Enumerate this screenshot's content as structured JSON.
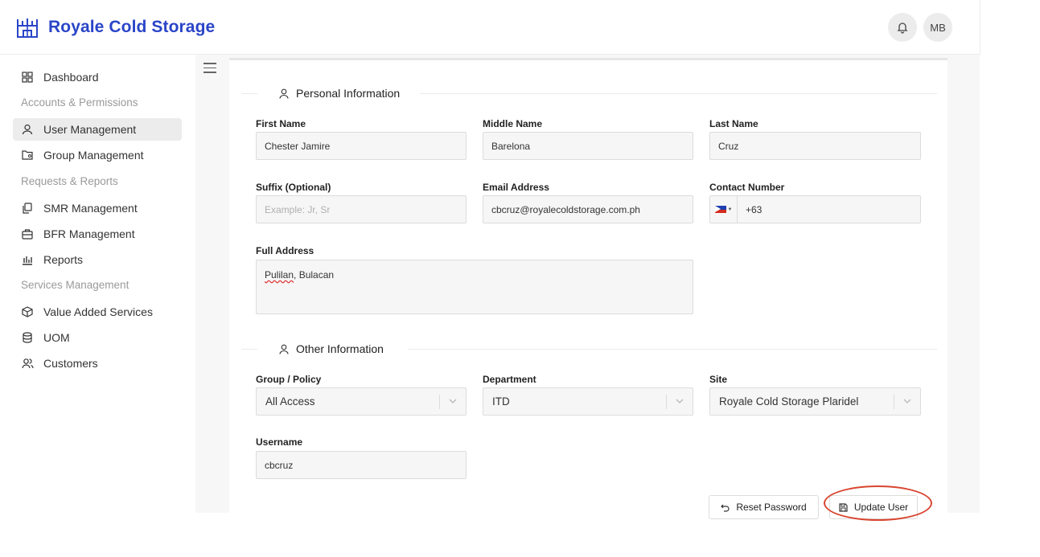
{
  "brand": {
    "name": "Royale Cold Storage"
  },
  "header": {
    "avatar_initials": "MB"
  },
  "sidebar": {
    "dashboard": "Dashboard",
    "section_accounts": "Accounts & Permissions",
    "user_management": "User Management",
    "group_management": "Group Management",
    "section_requests": "Requests & Reports",
    "smr_management": "SMR Management",
    "bfr_management": "BFR Management",
    "reports": "Reports",
    "section_services": "Services Management",
    "value_added_services": "Value Added Services",
    "uom": "UOM",
    "customers": "Customers"
  },
  "personal": {
    "title": "Personal Information",
    "first_name_label": "First Name",
    "first_name": "Chester Jamire",
    "middle_name_label": "Middle Name",
    "middle_name": "Barelona",
    "last_name_label": "Last Name",
    "last_name": "Cruz",
    "suffix_label": "Suffix (Optional)",
    "suffix_placeholder": "Example: Jr, Sr",
    "email_label": "Email Address",
    "email": "cbcruz@royalecoldstorage.com.ph",
    "contact_label": "Contact Number",
    "contact": "+63",
    "address_label": "Full Address",
    "address_part1": "Pulilan",
    "address_part2": ", Bulacan"
  },
  "other": {
    "title": "Other Information",
    "group_label": "Group / Policy",
    "group": "All Access",
    "department_label": "Department",
    "department": "ITD",
    "site_label": "Site",
    "site": "Royale Cold Storage Plaridel",
    "username_label": "Username",
    "username": "cbcruz"
  },
  "actions": {
    "reset_password": "Reset Password",
    "update_user": "Update User"
  },
  "colors": {
    "brand": "#2a45c8",
    "highlight_oval": "#d9452f"
  }
}
